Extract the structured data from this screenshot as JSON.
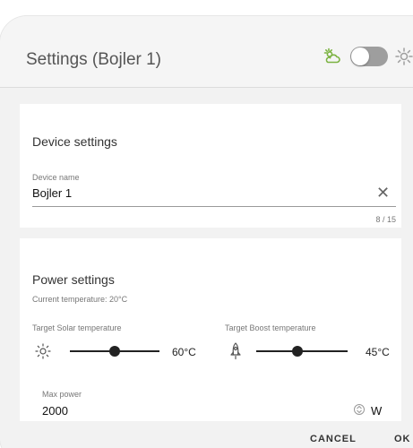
{
  "header": {
    "title": "Settings (Bojler 1)",
    "icons": [
      "sun-cloud-icon",
      "toggle-switch",
      "sun-gear-icon"
    ],
    "accent_color": "#7cb342"
  },
  "device_settings": {
    "section_title": "Device settings",
    "name_label": "Device name",
    "name_value": "Bojler 1",
    "char_counter": "8 / 15"
  },
  "power_settings": {
    "section_title": "Power settings",
    "current_temperature": "Current temperature: 20°C",
    "solar": {
      "label": "Target Solar temperature",
      "value_text": "60°C",
      "level": 0.5
    },
    "boost": {
      "label": "Target Boost temperature",
      "value_text": "45°C",
      "level": 0.45
    },
    "max_power": {
      "label": "Max power",
      "value": "2000",
      "unit": "W"
    }
  },
  "footer": {
    "cancel_label": "CANCEL",
    "ok_label": "OK"
  }
}
